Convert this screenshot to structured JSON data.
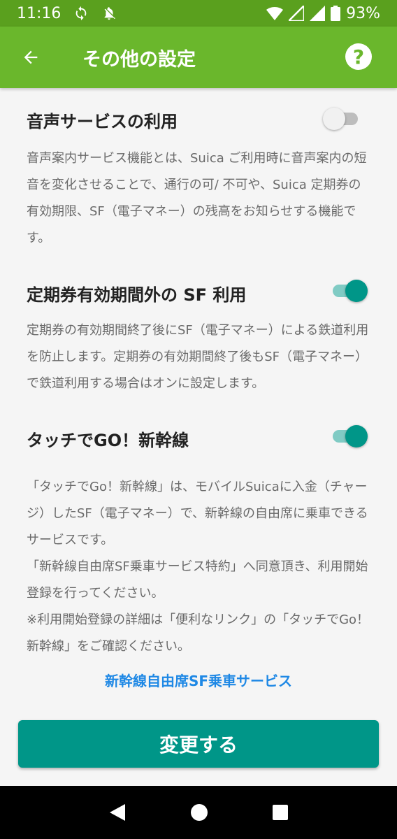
{
  "status_bar": {
    "time": "11:16",
    "battery": "93%"
  },
  "app_bar": {
    "title": "その他の設定",
    "help_icon": "?"
  },
  "settings": [
    {
      "title": "音声サービスの利用",
      "enabled": false,
      "description": "音声案内サービス機能とは、Suica ご利用時に音声案内の短音を変化させることで、通行の可/ 不可や、Suica 定期券の有効期限、SF（電子マネー）の残高をお知らせする機能です。"
    },
    {
      "title": "定期券有効期間外の SF 利用",
      "enabled": true,
      "description": "定期券の有効期間終了後にSF（電子マネー）による鉄道利用を防止します。定期券の有効期間終了後もSF（電子マネー）で鉄道利用する場合はオンに設定します。"
    },
    {
      "title": "タッチでGO！新幹線",
      "enabled": true,
      "description": "「タッチでGo！新幹線」は、モバイルSuicaに入金（チャージ）したSF（電子マネー）で、新幹線の自由席に乗車できるサービスです。\n「新幹線自由席SF乗車サービス特約」へ同意頂き、利用開始登録を行ってください。\n※利用開始登録の詳細は「便利なリンク」の「タッチでGo！新幹線」をご確認ください。"
    }
  ],
  "link_text": "新幹線自由席SF乗車サービス",
  "change_button": "変更する",
  "colors": {
    "status_bar": "#5aa01e",
    "app_bar": "#6ab72c",
    "accent": "#009688",
    "link": "#1e88e5"
  }
}
